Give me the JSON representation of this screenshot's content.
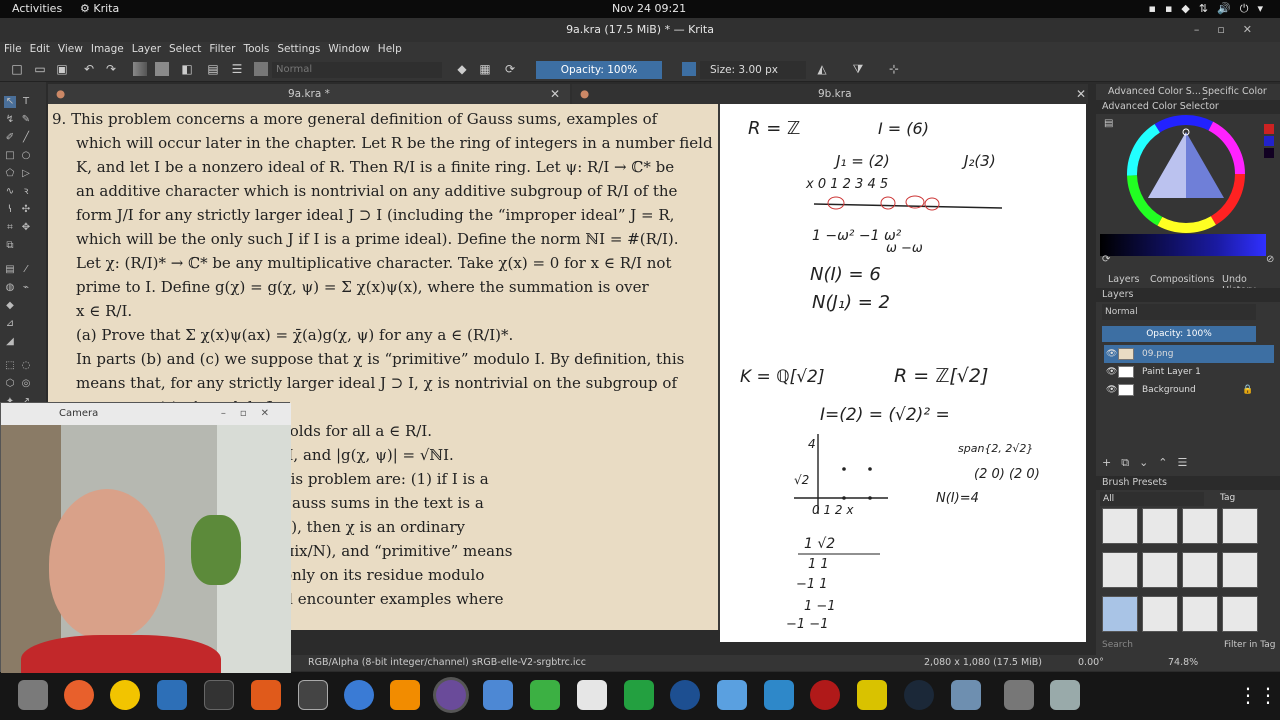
{
  "system_bar": {
    "activities": "Activities",
    "app": "Krita",
    "clock": "Nov 24  09:21"
  },
  "window": {
    "title": "9a.kra (17.5 MiB)  * — Krita"
  },
  "menu": [
    "File",
    "Edit",
    "View",
    "Image",
    "Layer",
    "Select",
    "Filter",
    "Tools",
    "Settings",
    "Window",
    "Help"
  ],
  "toolbar": {
    "blend_mode": "Normal",
    "opacity": "Opacity: 100%",
    "size": "Size: 3.00 px"
  },
  "tabs": [
    {
      "label": "9a.kra *"
    },
    {
      "label": "9b.kra"
    }
  ],
  "problem_text": [
    "9.  This problem concerns a more general definition of Gauss sums, examples of",
    "which will occur later in the chapter. Let R be the ring of integers in a number field",
    "K, and let I be a nonzero ideal of R. Then R/I is a finite ring. Let ψ: R/I → ℂ* be",
    "an additive character which is nontrivial on any additive subgroup of R/I of the",
    "form J/I for any strictly larger ideal J ⊃ I (including the “improper ideal” J = R,",
    "which will be the only such J if I is a prime ideal). Define the norm ℕI = #(R/I).",
    "Let χ: (R/I)* → ℂ* be any multiplicative character. Take χ(x) = 0 for x ∈ R/I not",
    "prime to I. Define g(χ) = g(χ, ψ) = Σ χ(x)ψ(x), where the summation is over",
    "x ∈ R/I.",
    "(a)  Prove that Σ χ(x)ψ(ax) = χ̄(a)g(χ, ψ) for any a ∈ (R/I)*.",
    "In parts (b) and (c) we suppose that χ is “primitive” modulo I. By definition, this",
    "means that, for any strictly larger ideal J ⊃ I, χ is nontrivial on the subgroup of",
    "                          s congruent to 1 modulo J.",
    "                          hat the formula in part (a) holds for all a ∈ R/I.",
    "                          hat g(χ, ψ)g(χ̄, ψ) = χ(−1)ℕI, and |g(χ, ψ)| = √ℕI.",
    "                          acters and Gauss sums in this problem are: (1) if I is a",
    "                          ld 𝔽q, then property (2) of Gauss sums in the text is a",
    "                          if R = ℤ and I is the ideal (N), then χ is an ordinary",
    "                          , we often take ψ(x) = e^(2πix/N), and “primitive” means",
    "                          =(ℤ/Nℤ)* does not depend only on its residue modulo",
    "                          ) later in the chapter we will encounter examples where"
  ],
  "notes": {
    "l1": "R = ℤ",
    "l2": "I = (6)",
    "l3": "J₁ = (2)",
    "l4": "J₂(3)",
    "l5": "x   0   1   2   3   4   5",
    "l6": "1  −ω²  −1  ω²",
    "l7": "ω        −ω",
    "l8": "N(I) = 6",
    "l9": "N(J₁) = 2",
    "l10": "K = ℚ[√2]",
    "l11": "R = ℤ[√2]",
    "l12": "I=(2) = (√2)² =",
    "l13": "span{2, 2√2}",
    "l14": "(2 0) (2 0)",
    "l15": "N(I)=4",
    "l16": "1    √2",
    "l17": "1     1",
    "l18": "−1     1",
    "l19": "1    −1",
    "l20": "−1   −1",
    "l21": "√2",
    "l22": "4",
    "l23": "0   1   2   x"
  },
  "right_panel": {
    "color_tab1": "Advanced Color S...",
    "color_tab2": "Specific Color S...",
    "color_title": "Advanced Color Selector",
    "tab_layers": "Layers",
    "tab_compositions": "Compositions",
    "tab_undo": "Undo History",
    "layers_title": "Layers",
    "blend": "Normal",
    "opacity": "Opacity:  100%",
    "layers": [
      {
        "name": "09.png"
      },
      {
        "name": "Paint Layer 1"
      },
      {
        "name": "Background"
      }
    ],
    "brush_presets": "Brush Presets",
    "brush_filter": "All",
    "tag": "Tag",
    "search": "Search",
    "filter_in_tag": "Filter in Tag"
  },
  "status": {
    "color": "RGB/Alpha (8-bit integer/channel)  sRGB-elle-V2-srgbtrc.icc",
    "dims": "2,080 x 1,080 (17.5 MiB)",
    "rotation": "0.00°",
    "zoom": "74.8%"
  },
  "camera": {
    "title": "Camera"
  },
  "colors": {
    "accent": "#3d6fa3",
    "paper": "#e9dcc4",
    "panel": "#353535"
  },
  "icons": [
    "files-icon",
    "firefox-icon",
    "rhythmbox-icon",
    "libreoffice-writer-icon",
    "terminal-icon",
    "software-icon",
    "texmaker-icon",
    "chromium-icon",
    "vlc-icon",
    "krita-icon",
    "text-editor-icon",
    "money-icon",
    "solitaire-icon",
    "spreadsheet-icon",
    "thunderbird-icon",
    "kdenlive-icon",
    "app-icon",
    "cherry-icon",
    "puzzle-icon",
    "steam-icon",
    "settings-icon",
    "unknown-icon",
    "trash-icon",
    "app-grid-icon"
  ]
}
